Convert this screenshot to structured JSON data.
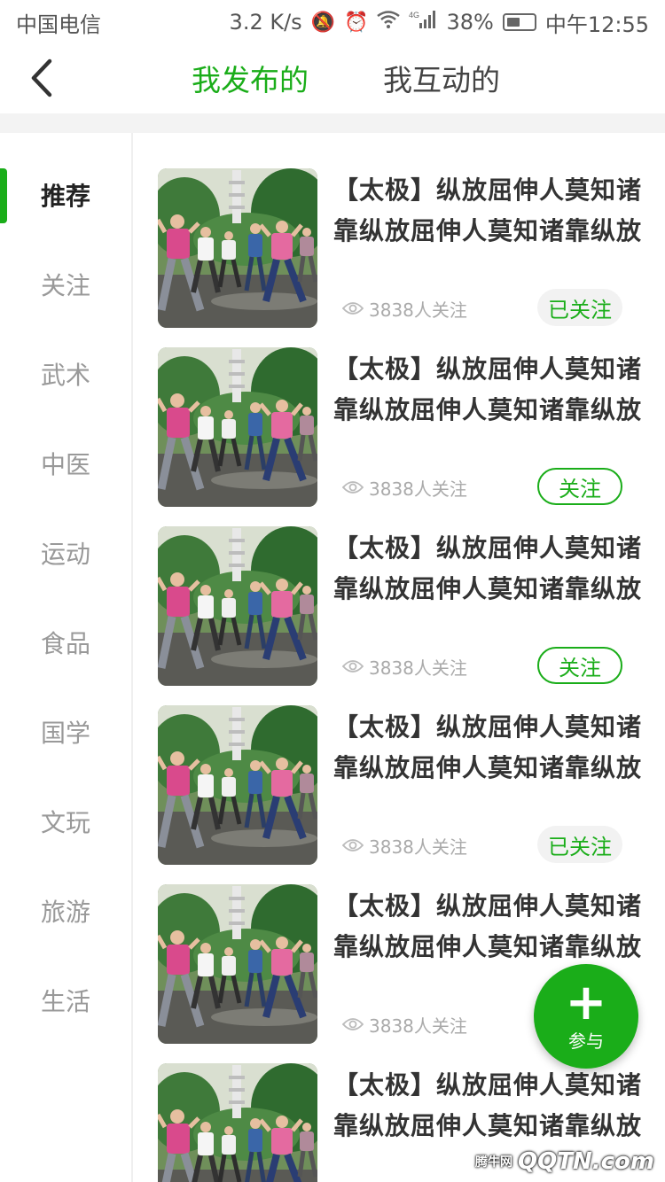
{
  "status_bar": {
    "carrier": "中国电信",
    "speed": "3.2 K/s",
    "network": "4G",
    "battery": "38%",
    "time": "中午12:55"
  },
  "nav": {
    "tabs": [
      {
        "label": "我发布的",
        "active": true
      },
      {
        "label": "我互动的",
        "active": false
      }
    ]
  },
  "sidebar": {
    "items": [
      {
        "label": "推荐",
        "active": true
      },
      {
        "label": "关注"
      },
      {
        "label": "武术"
      },
      {
        "label": "中医"
      },
      {
        "label": "运动"
      },
      {
        "label": "食品"
      },
      {
        "label": "国学"
      },
      {
        "label": "文玩"
      },
      {
        "label": "旅游"
      },
      {
        "label": "生活"
      }
    ]
  },
  "feed": {
    "items": [
      {
        "title": "【太极】纵放屈伸人莫知诸靠纵放屈伸人莫知诸靠纵放",
        "followers": "3838人关注",
        "button": "已关注",
        "followed": true
      },
      {
        "title": "【太极】纵放屈伸人莫知诸靠纵放屈伸人莫知诸靠纵放",
        "followers": "3838人关注",
        "button": "关注",
        "followed": false
      },
      {
        "title": "【太极】纵放屈伸人莫知诸靠纵放屈伸人莫知诸靠纵放",
        "followers": "3838人关注",
        "button": "关注",
        "followed": false
      },
      {
        "title": "【太极】纵放屈伸人莫知诸靠纵放屈伸人莫知诸靠纵放",
        "followers": "3838人关注",
        "button": "已关注",
        "followed": true
      },
      {
        "title": "【太极】纵放屈伸人莫知诸靠纵放屈伸人莫知诸靠纵放",
        "followers": "3838人关注",
        "button": "",
        "followed": null
      },
      {
        "title": "【太极】纵放屈伸人莫知诸靠纵放屈伸人莫知诸靠纵放",
        "followers": "",
        "button": "",
        "followed": null
      }
    ]
  },
  "fab": {
    "label": "参与"
  },
  "watermark": {
    "text": "QQTN.com",
    "sub": "腾牛网"
  },
  "colors": {
    "accent": "#1aad19",
    "text": "#333333",
    "muted": "#999999"
  }
}
